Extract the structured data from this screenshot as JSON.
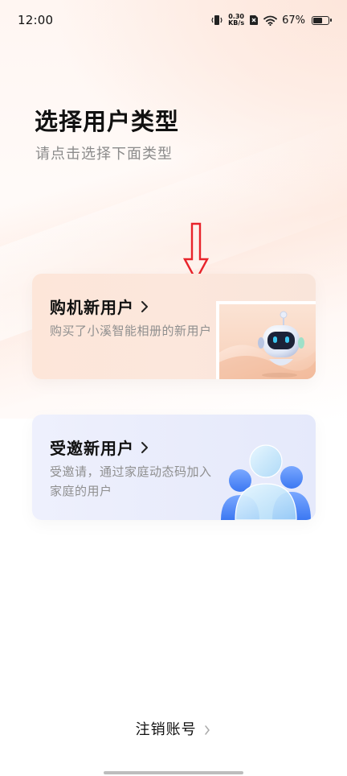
{
  "status_bar": {
    "time": "12:00",
    "net_speed_value": "0.30",
    "net_speed_unit": "KB/s",
    "battery_percent": "67%",
    "battery_level": 0.67,
    "icons": [
      "vibrate-icon",
      "sim-off-icon",
      "wifi-icon",
      "battery-icon"
    ]
  },
  "header": {
    "title": "选择用户类型",
    "subtitle": "请点击选择下面类型"
  },
  "cards": {
    "buyer": {
      "title": "购机新用户",
      "description": "购买了小溪智能相册的新用户"
    },
    "invitee": {
      "title": "受邀新用户",
      "description": "受邀请，通过家庭动态码加入家庭的用户"
    }
  },
  "footer": {
    "logout_label": "注销账号"
  },
  "colors": {
    "arrow": "#e8242b",
    "buyer_card": "#fce7dc",
    "invite_card": "#eceffc",
    "robot_eye": "#3ec7f0"
  }
}
